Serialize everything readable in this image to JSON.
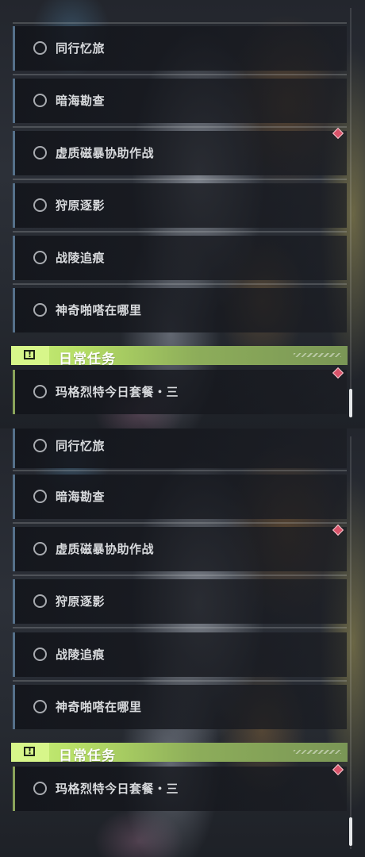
{
  "panels": [
    {
      "quests": [
        {
          "label": "同行忆旅",
          "tracked": false
        },
        {
          "label": "暗海勘查",
          "tracked": false
        },
        {
          "label": "虚质磁暴协助作战",
          "tracked": false
        },
        {
          "label": "狩原逐影",
          "tracked": false
        },
        {
          "label": "战陵追痕",
          "tracked": false
        },
        {
          "label": "神奇啪嗒在哪里",
          "tracked": false
        }
      ],
      "daily_section": {
        "title": "日常任务"
      },
      "daily_quests": [
        {
          "label": "玛格烈特今日套餐・三",
          "tracked": false
        }
      ],
      "scroll_position": 0.95
    },
    {
      "quests": [
        {
          "label": "同行忆旅",
          "tracked": false
        },
        {
          "label": "暗海勘查",
          "tracked": false
        },
        {
          "label": "虚质磁暴协助作战",
          "tracked": false
        },
        {
          "label": "狩原逐影",
          "tracked": false
        },
        {
          "label": "战陵追痕",
          "tracked": false
        },
        {
          "label": "神奇啪嗒在哪里",
          "tracked": false
        }
      ],
      "daily_section": {
        "title": "日常任务"
      },
      "daily_quests": [
        {
          "label": "玛格烈特今日套餐・三",
          "tracked": false
        }
      ],
      "scroll_position": 1.0
    }
  ],
  "colors": {
    "daily_accent": "#b6de66",
    "quest_marker": "#d9536a",
    "row_border": "#55708a"
  },
  "icons": {
    "quest_status": "hollow-circle",
    "new_marker": "red-diamond",
    "daily_header": "exclamation-box"
  }
}
